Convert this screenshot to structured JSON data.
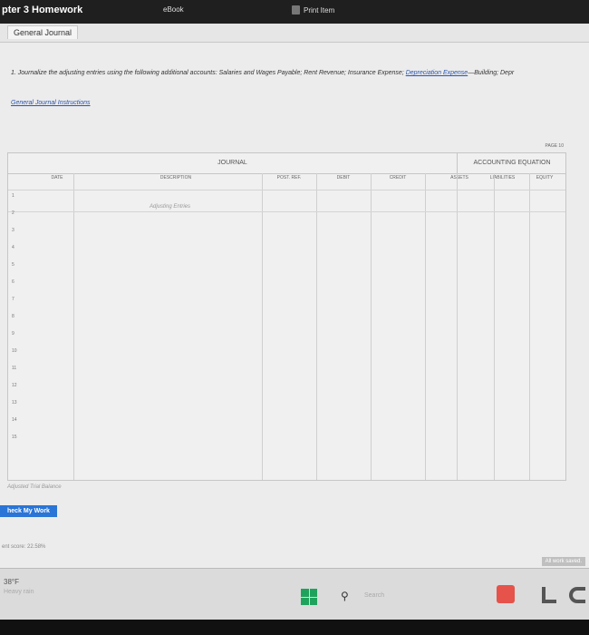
{
  "topbar": {
    "title": "pter 3 Homework",
    "ebook": "eBook",
    "print": "Print Item"
  },
  "tabs": {
    "active": "General Journal"
  },
  "instructions": {
    "text": "1. Journalize the adjusting entries using the following additional accounts: Salaries and Wages Payable; Rent Revenue; Insurance Expense; ",
    "link": "Depreciation Expense",
    "tail": "—Building; Depr"
  },
  "journal_link": "General Journal Instructions",
  "journal": {
    "page": "PAGE 10",
    "title": "JOURNAL",
    "equation_title": "ACCOUNTING EQUATION",
    "columns": {
      "date": "DATE",
      "description": "DESCRIPTION",
      "post_ref": "POST. REF.",
      "debit": "DEBIT",
      "credit": "CREDIT",
      "assets": "ASSETS",
      "liabilities": "LIABILITIES",
      "equity": "EQUITY"
    },
    "adjusting_label": "Adjusting Entries",
    "row_numbers": [
      "1",
      "2",
      "3",
      "4",
      "5",
      "6",
      "7",
      "8",
      "9",
      "10",
      "11",
      "12",
      "13",
      "14",
      "15"
    ]
  },
  "adjusted_trial_balance": "Adjusted Trial Balance",
  "check_button": "heck My Work",
  "score": "ent score: 22.58%",
  "saved": "All work saved.",
  "taskbar": {
    "temp": "38°F",
    "weather": "Heavy rain",
    "search": "Search"
  }
}
